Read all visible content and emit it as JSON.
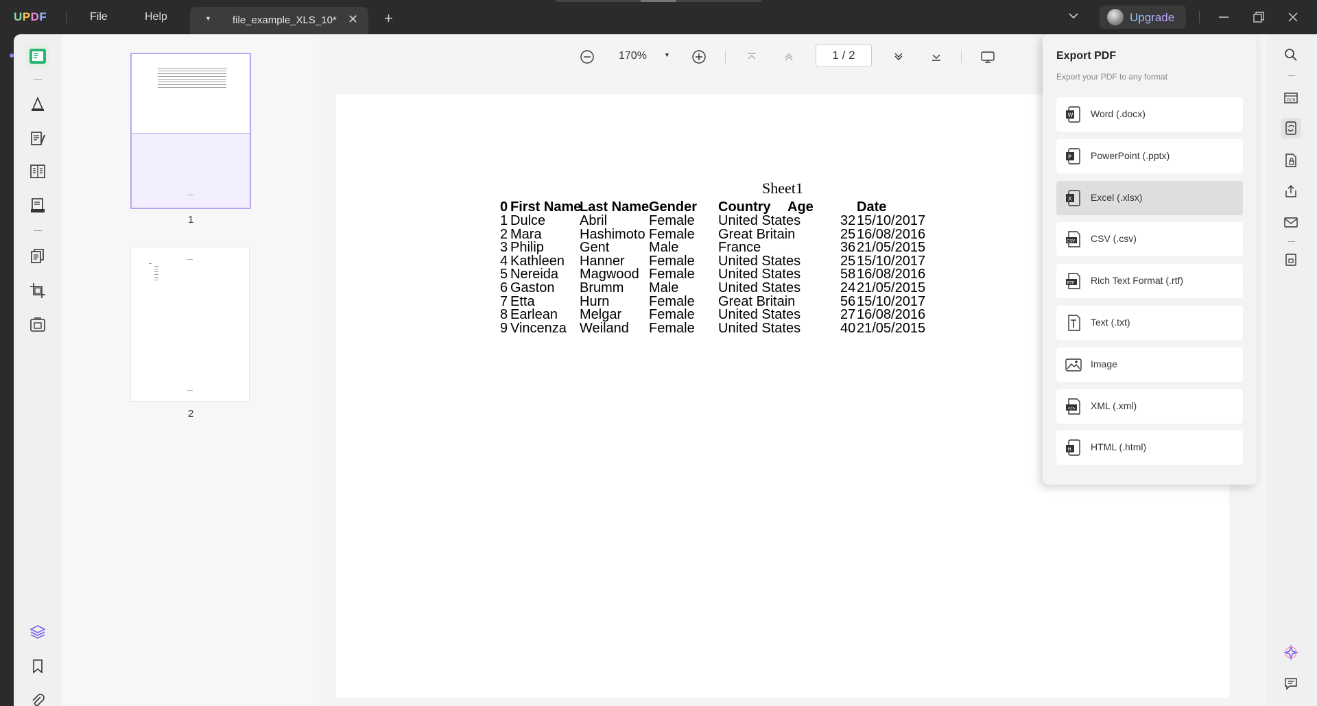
{
  "app": {
    "logo": "UPDF",
    "menu_file": "File",
    "menu_help": "Help",
    "tab_title": "file_example_XLS_10*",
    "upgrade_label": "Upgrade",
    "accent": "#9b7cf6"
  },
  "viewer": {
    "zoom": "170%",
    "page_current": "1",
    "page_sep": "/",
    "page_total": "2"
  },
  "thumbnails": [
    {
      "label": "1"
    },
    {
      "label": "2"
    }
  ],
  "document": {
    "sheet_title": "Sheet1",
    "headers": [
      "0",
      "First Name",
      "Last Name",
      "Gender",
      "Country",
      "Age",
      "Date"
    ],
    "rows": [
      [
        "1",
        "Dulce",
        "Abril",
        "Female",
        "United States",
        "32",
        "15/10/2017"
      ],
      [
        "2",
        "Mara",
        "Hashimoto",
        "Female",
        "Great Britain",
        "25",
        "16/08/2016"
      ],
      [
        "3",
        "Philip",
        "Gent",
        "Male",
        "France",
        "36",
        "21/05/2015"
      ],
      [
        "4",
        "Kathleen",
        "Hanner",
        "Female",
        "United States",
        "25",
        "15/10/2017"
      ],
      [
        "5",
        "Nereida",
        "Magwood",
        "Female",
        "United States",
        "58",
        "16/08/2016"
      ],
      [
        "6",
        "Gaston",
        "Brumm",
        "Male",
        "United States",
        "24",
        "21/05/2015"
      ],
      [
        "7",
        "Etta",
        "Hurn",
        "Female",
        "Great Britain",
        "56",
        "15/10/2017"
      ],
      [
        "8",
        "Earlean",
        "Melgar",
        "Female",
        "United States",
        "27",
        "16/08/2016"
      ],
      [
        "9",
        "Vincenza",
        "Weiland",
        "Female",
        "United States",
        "40",
        "21/05/2015"
      ]
    ]
  },
  "export_panel": {
    "title": "Export PDF",
    "subtitle": "Export your PDF to any format",
    "items": [
      {
        "label": "Word (.docx)",
        "icon": "word-icon"
      },
      {
        "label": "PowerPoint (.pptx)",
        "icon": "powerpoint-icon"
      },
      {
        "label": "Excel (.xlsx)",
        "icon": "excel-icon"
      },
      {
        "label": "CSV (.csv)",
        "icon": "csv-icon"
      },
      {
        "label": "Rich Text Format (.rtf)",
        "icon": "rtf-icon"
      },
      {
        "label": "Text (.txt)",
        "icon": "text-icon"
      },
      {
        "label": "Image",
        "icon": "image-icon"
      },
      {
        "label": "XML (.xml)",
        "icon": "xml-icon"
      },
      {
        "label": "HTML (.html)",
        "icon": "html-icon"
      }
    ],
    "selected": "Excel (.xlsx)"
  }
}
